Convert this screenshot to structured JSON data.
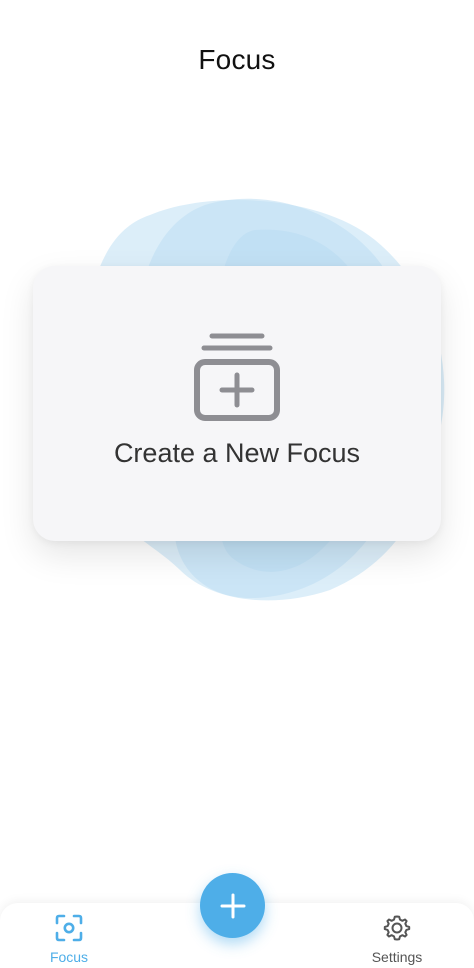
{
  "header": {
    "title": "Focus"
  },
  "empty_state": {
    "label": "Create a New Focus",
    "icon": "stacked-folder-plus-icon"
  },
  "fab": {
    "icon": "plus-icon"
  },
  "tabbar": {
    "tabs": [
      {
        "label": "Focus",
        "icon": "focus-viewfinder-icon",
        "active": true
      },
      {
        "label": "Settings",
        "icon": "gear-icon",
        "active": false
      }
    ]
  },
  "colors": {
    "accent": "#4eaee8",
    "blob_light": "#d3e9f7",
    "blob_mid": "#bcdcf3",
    "card_bg": "#f6f6f8",
    "icon_gray": "#8e8e93",
    "label_dark": "#333333",
    "inactive_tab": "#555555"
  }
}
